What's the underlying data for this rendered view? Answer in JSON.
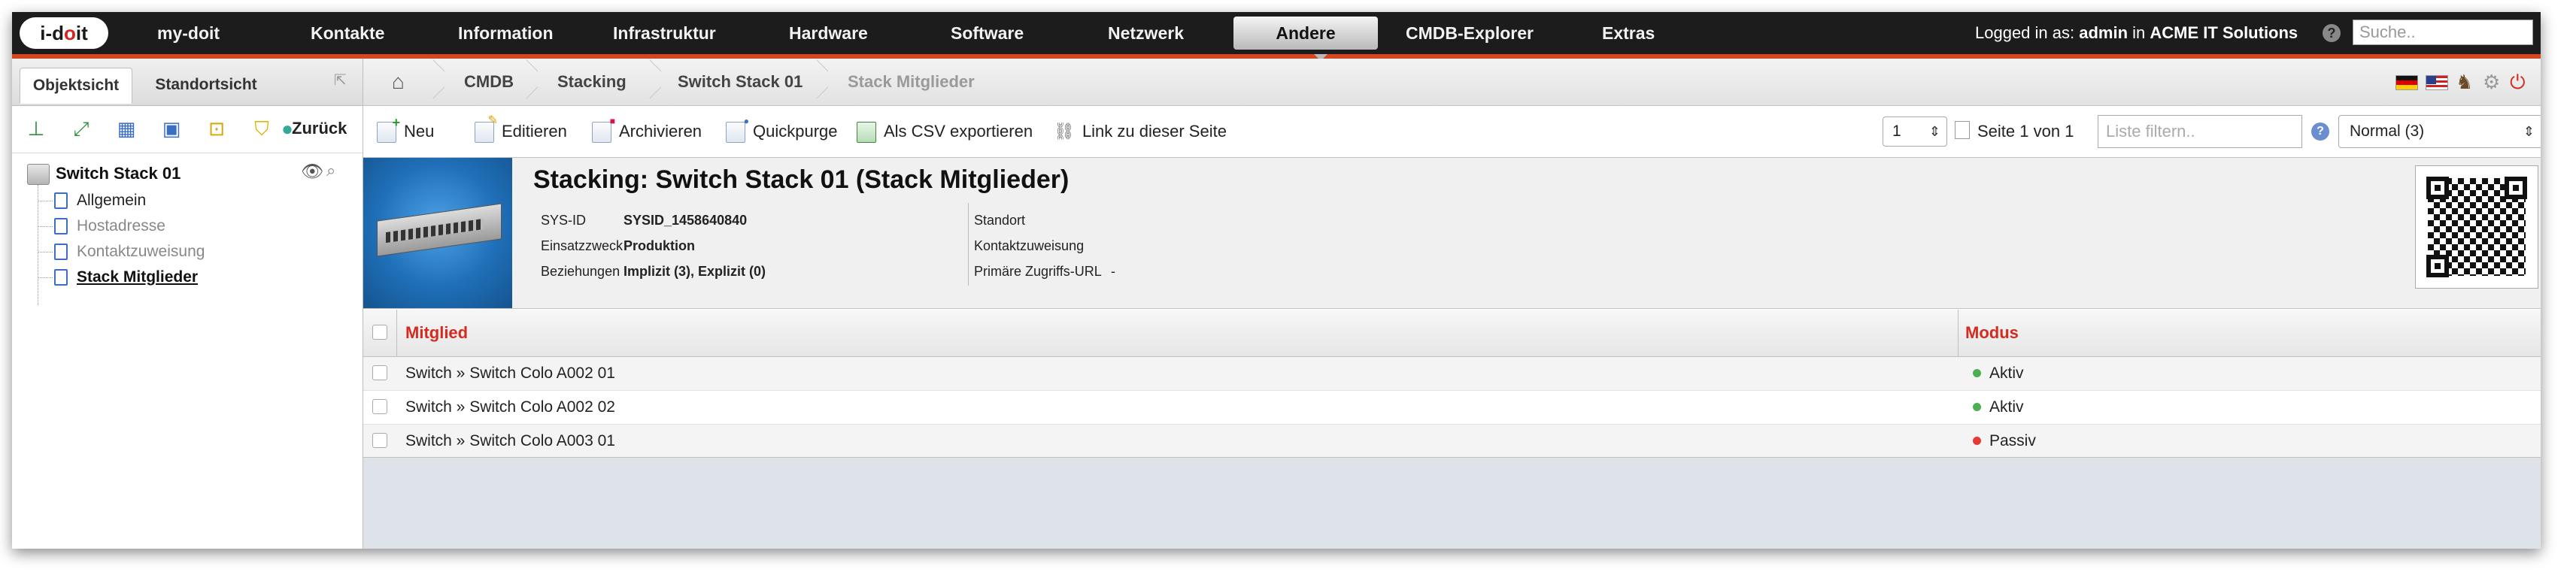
{
  "nav": {
    "logo": "i-doit",
    "items": [
      {
        "label": "my-doit"
      },
      {
        "label": "Kontakte"
      },
      {
        "label": "Information"
      },
      {
        "label": "Infrastruktur"
      },
      {
        "label": "Hardware"
      },
      {
        "label": "Software"
      },
      {
        "label": "Netzwerk"
      },
      {
        "label": "Andere",
        "active": true
      },
      {
        "label": "CMDB-Explorer"
      },
      {
        "label": "Extras"
      }
    ],
    "login_prefix": "Logged in as:",
    "login_user": "admin",
    "login_in": "in",
    "login_org": "ACME IT Solutions",
    "search_placeholder": "Suche.."
  },
  "left": {
    "tabs": [
      {
        "label": "Objektsicht",
        "active": true
      },
      {
        "label": "Standortsicht"
      }
    ],
    "toolbar_back": "Zurück",
    "tree": {
      "root": "Switch Stack 01",
      "items": [
        {
          "label": "Allgemein",
          "state": "normal"
        },
        {
          "label": "Hostadresse",
          "state": "muted"
        },
        {
          "label": "Kontaktzuweisung",
          "state": "muted"
        },
        {
          "label": "Stack Mitglieder",
          "state": "current"
        }
      ]
    }
  },
  "breadcrumb": [
    "CMDB",
    "Stacking",
    "Switch Stack 01",
    "Stack Mitglieder"
  ],
  "actions": {
    "new": "Neu",
    "edit": "Editieren",
    "archive": "Archivieren",
    "quickpurge": "Quickpurge",
    "csv": "Als CSV exportieren",
    "link": "Link zu dieser Seite",
    "page_select": "1",
    "page_text": "Seite 1 von 1",
    "filter_placeholder": "Liste filtern..",
    "mode": "Normal (3)"
  },
  "object": {
    "title": "Stacking: Switch Stack 01 (Stack Mitglieder)",
    "fields": [
      {
        "label": "SYS-ID",
        "value": "SYSID_1458640840"
      },
      {
        "label": "Einsatzzweck",
        "value": "Produktion"
      },
      {
        "label": "Beziehungen",
        "value": "Implizit (3), Explizit (0)"
      }
    ],
    "right_fields": [
      {
        "label": "Standort",
        "value": ""
      },
      {
        "label": "Kontaktzuweisung",
        "value": ""
      },
      {
        "label": "Primäre Zugriffs-URL",
        "value": "-"
      }
    ]
  },
  "table": {
    "columns": [
      "Mitglied",
      "Modus"
    ],
    "rows": [
      {
        "member": "Switch » Switch Colo A002 01",
        "mode": "Aktiv",
        "status_color": "#4caf50"
      },
      {
        "member": "Switch » Switch Colo A002 02",
        "mode": "Aktiv",
        "status_color": "#4caf50"
      },
      {
        "member": "Switch » Switch Colo A003 01",
        "mode": "Passiv",
        "status_color": "#e53935"
      }
    ]
  },
  "colors": {
    "accent": "#d4461f",
    "column_header": "#d42a1f",
    "nav_bg": "#1c1c1c"
  }
}
